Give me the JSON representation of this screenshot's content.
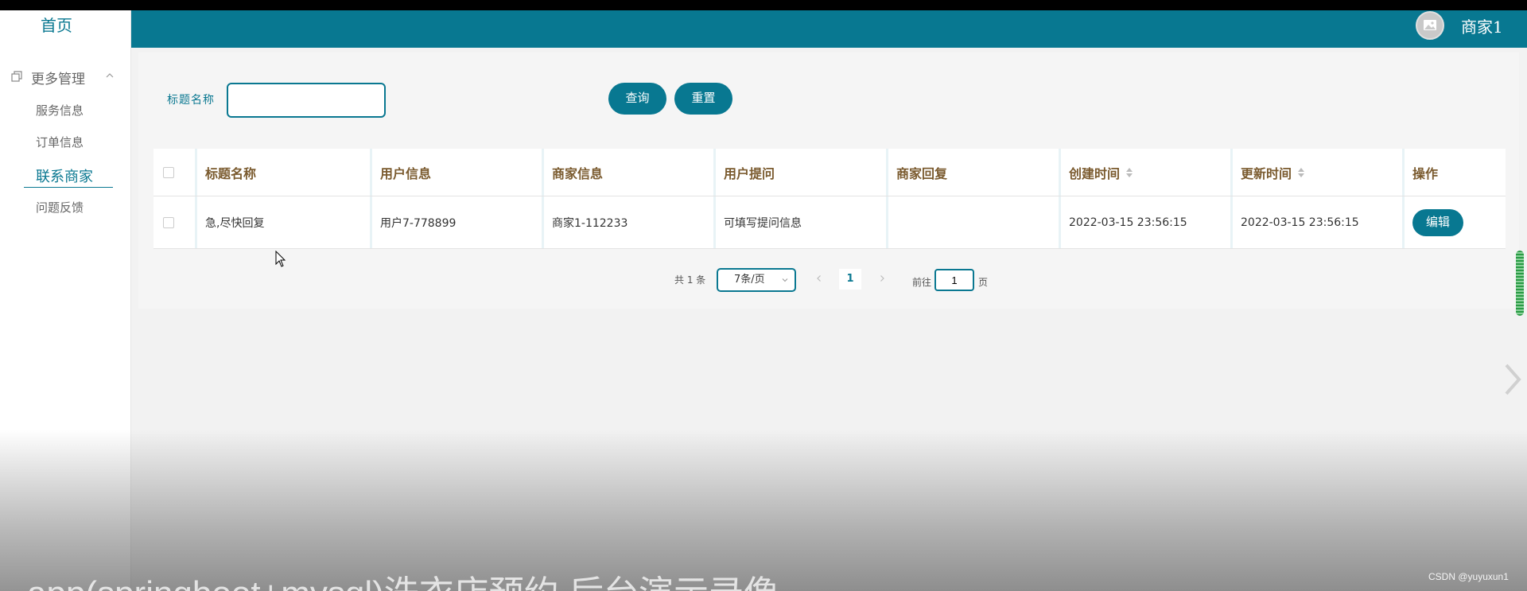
{
  "sidebar": {
    "home": "首页",
    "group_label": "更多管理",
    "items": [
      {
        "label": "服务信息",
        "active": false
      },
      {
        "label": "订单信息",
        "active": false
      },
      {
        "label": "联系商家",
        "active": true
      },
      {
        "label": "问题反馈",
        "active": false
      }
    ]
  },
  "header": {
    "user_name": "商家1",
    "bg_color": "#087891"
  },
  "search": {
    "label": "标题名称",
    "value": "",
    "placeholder": "",
    "query_label": "查询",
    "reset_label": "重置"
  },
  "table": {
    "columns": [
      "",
      "标题名称",
      "用户信息",
      "商家信息",
      "用户提问",
      "商家回复",
      "创建时间",
      "更新时间",
      "操作"
    ],
    "rows": [
      {
        "title": "急,尽快回复",
        "user": "用户7-778899",
        "merchant": "商家1-112233",
        "question": "可填写提问信息",
        "reply": "",
        "created": "2022-03-15 23:56:15",
        "updated": "2022-03-15 23:56:15",
        "action": "编辑"
      }
    ]
  },
  "pagination": {
    "total": "共 1 条",
    "page_size": "7条/页",
    "current_page": "1",
    "goto_prefix": "前往",
    "goto_value": "1",
    "goto_suffix": "页"
  },
  "overlay": {
    "caption": "app(springboot+mysql)洗衣店预约 后台演示录像",
    "watermark": "CSDN @yuyuxun1"
  }
}
